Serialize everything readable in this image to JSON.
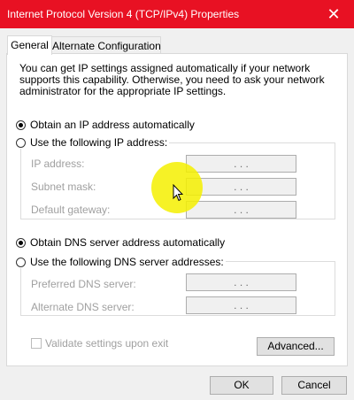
{
  "window": {
    "title": "Internet Protocol Version 4 (TCP/IPv4) Properties",
    "close_glyph": "✕",
    "titlebar_color": "#e81123"
  },
  "tabs": [
    {
      "label": "General",
      "active": true
    },
    {
      "label": "Alternate Configuration",
      "active": false
    }
  ],
  "general": {
    "description": "You can get IP settings assigned automatically if your network supports this capability. Otherwise, you need to ask your network administrator for the appropriate IP settings.",
    "ip_mode": {
      "auto_label": "Obtain an IP address automatically",
      "auto_selected": true,
      "manual_label": "Use the following IP address:",
      "manual_selected": false
    },
    "ip_fields": [
      {
        "label": "IP address:",
        "value": ". . ."
      },
      {
        "label": "Subnet mask:",
        "value": ". . ."
      },
      {
        "label": "Default gateway:",
        "value": ". . ."
      }
    ],
    "dns_mode": {
      "auto_label": "Obtain DNS server address automatically",
      "auto_selected": true,
      "manual_label": "Use the following DNS server addresses:",
      "manual_selected": false
    },
    "dns_fields": [
      {
        "label": "Preferred DNS server:",
        "value": ". . ."
      },
      {
        "label": "Alternate DNS server:",
        "value": ". . ."
      }
    ],
    "validate_label": "Validate settings upon exit",
    "validate_checked": false,
    "advanced_label": "Advanced..."
  },
  "footer": {
    "ok_label": "OK",
    "cancel_label": "Cancel"
  }
}
